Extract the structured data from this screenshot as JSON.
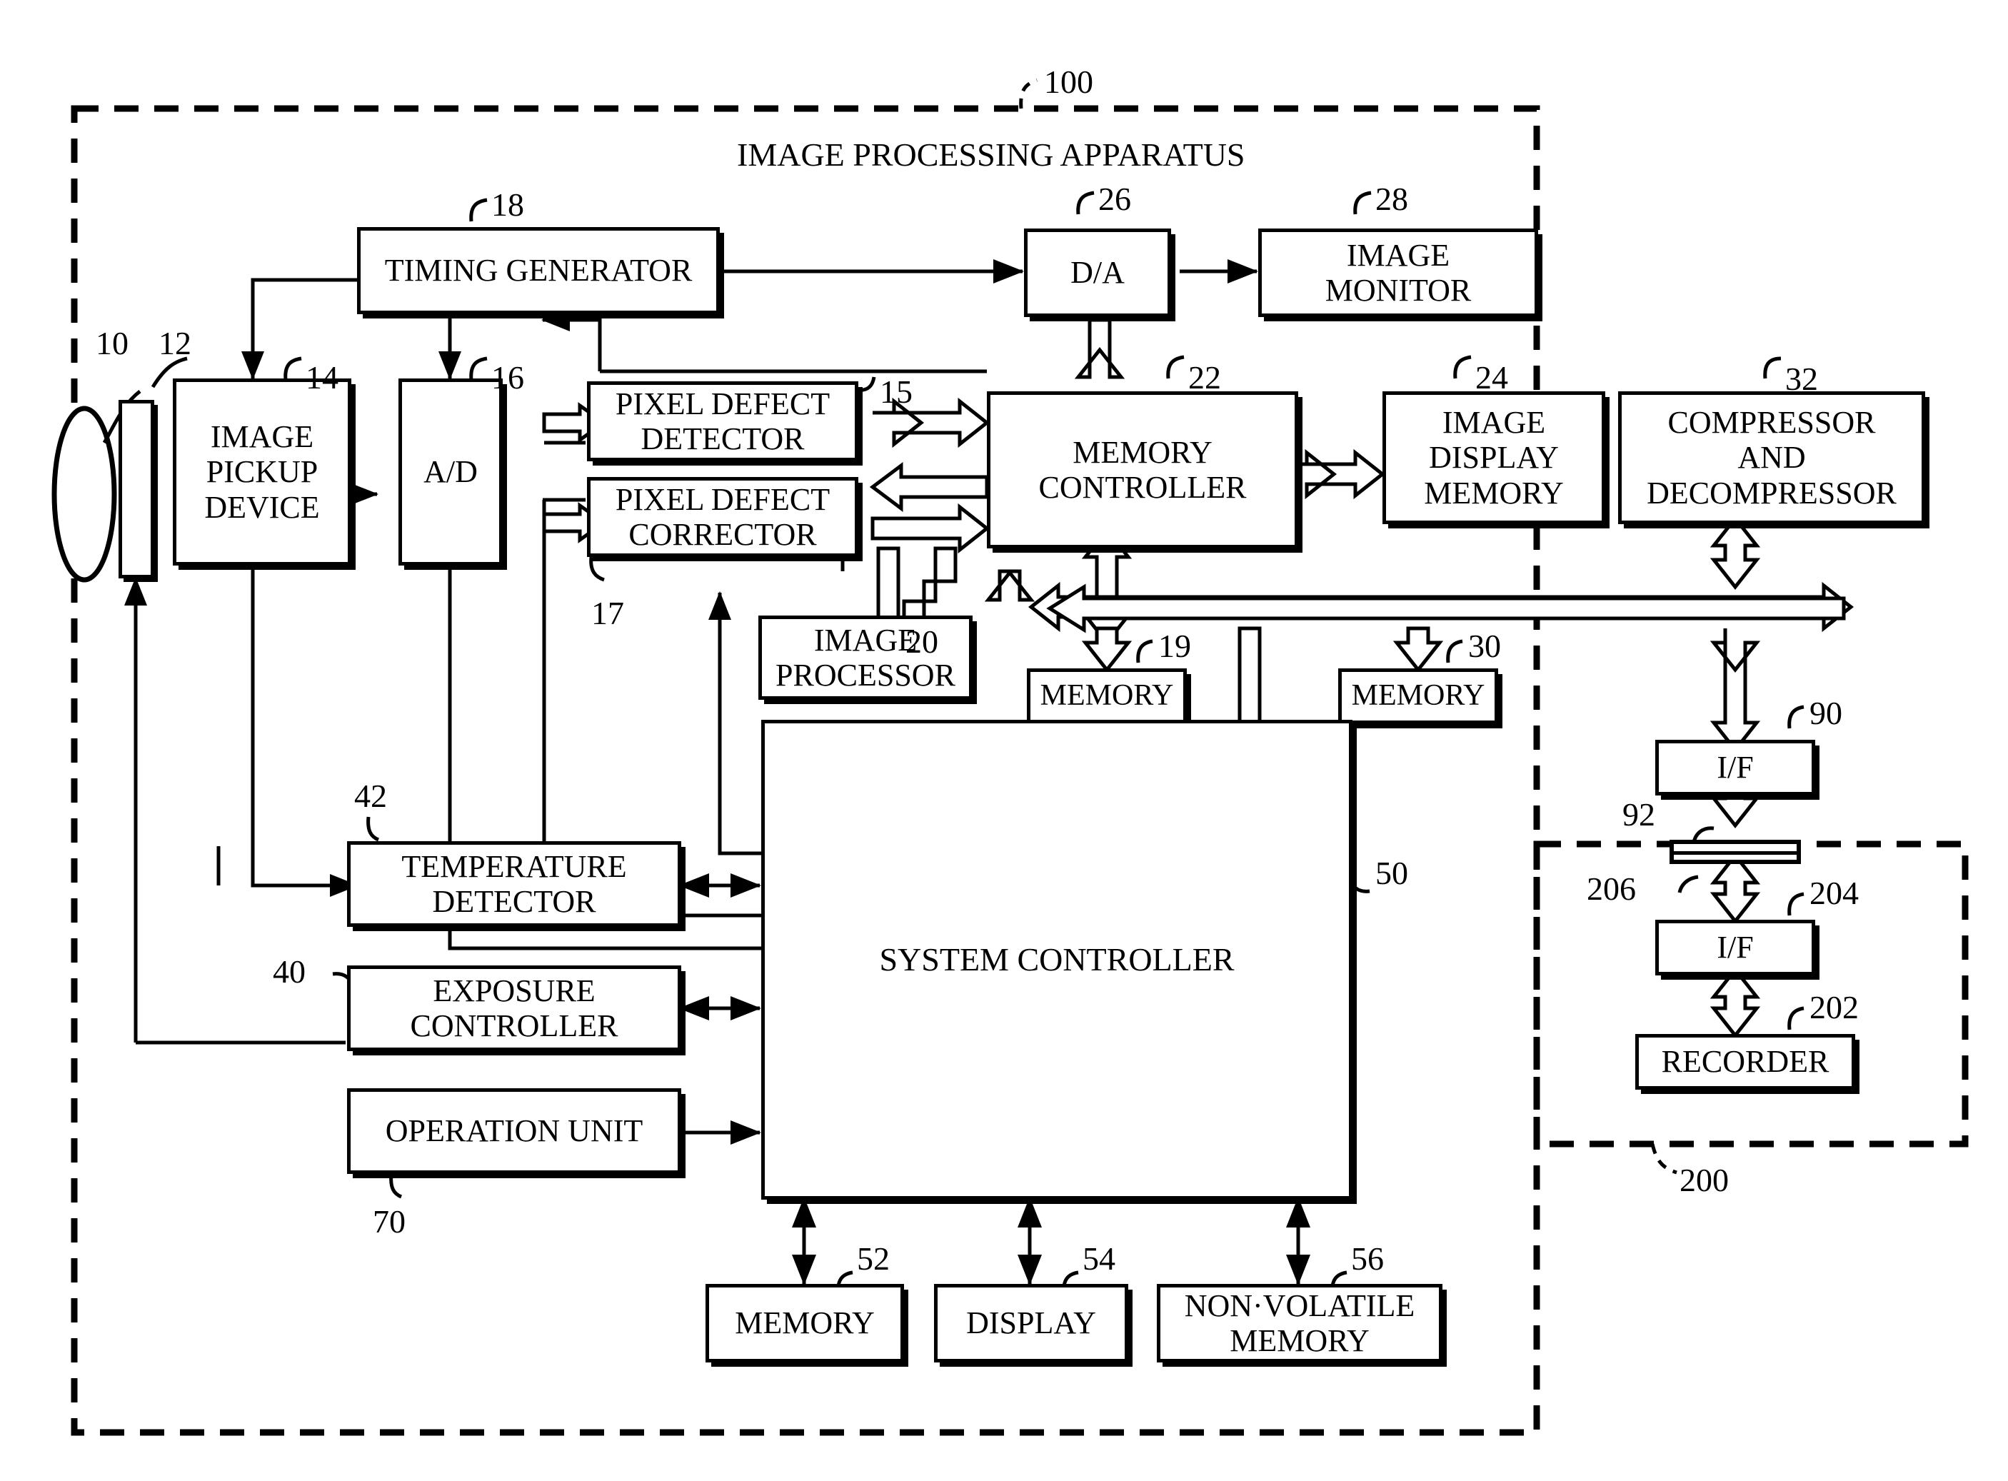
{
  "figure": {
    "title": "IMAGE PROCESSING APPARATUS",
    "apparatus_ref": "100",
    "recorder_unit_ref": "200"
  },
  "blocks": [
    {
      "id": "lens",
      "ref": "10",
      "label": ""
    },
    {
      "id": "shutter",
      "ref": "12",
      "label": ""
    },
    {
      "id": "image_pickup",
      "ref": "14",
      "label": "IMAGE\nPICKUP\nDEVICE"
    },
    {
      "id": "ad",
      "ref": "16",
      "label": "A/D"
    },
    {
      "id": "timing_gen",
      "ref": "18",
      "label": "TIMING GENERATOR"
    },
    {
      "id": "pixel_detector",
      "ref": "15",
      "label": "PIXEL DEFECT\nDETECTOR"
    },
    {
      "id": "pixel_corrector",
      "ref": "17",
      "label": "PIXEL DEFECT\nCORRECTOR"
    },
    {
      "id": "image_processor",
      "ref": "20",
      "label": "IMAGE\nPROCESSOR"
    },
    {
      "id": "memory_ctrl",
      "ref": "22",
      "label": "MEMORY\nCONTROLLER"
    },
    {
      "id": "memory19",
      "ref": "19",
      "label": "MEMORY"
    },
    {
      "id": "da",
      "ref": "26",
      "label": "D/A"
    },
    {
      "id": "image_monitor",
      "ref": "28",
      "label": "IMAGE\nMONITOR"
    },
    {
      "id": "image_disp_mem",
      "ref": "24",
      "label": "IMAGE\nDISPLAY\nMEMORY"
    },
    {
      "id": "compressor",
      "ref": "32",
      "label": "COMPRESSOR\nAND\nDECOMPRESSOR"
    },
    {
      "id": "memory30",
      "ref": "30",
      "label": "MEMORY"
    },
    {
      "id": "if90",
      "ref": "90",
      "label": "I/F"
    },
    {
      "id": "connector92",
      "ref": "92",
      "label": ""
    },
    {
      "id": "connector206",
      "ref": "206",
      "label": ""
    },
    {
      "id": "if204",
      "ref": "204",
      "label": "I/F"
    },
    {
      "id": "recorder",
      "ref": "202",
      "label": "RECORDER"
    },
    {
      "id": "temp_detector",
      "ref": "42",
      "label": "TEMPERATURE\nDETECTOR"
    },
    {
      "id": "exposure_ctrl",
      "ref": "40",
      "label": "EXPOSURE\nCONTROLLER"
    },
    {
      "id": "operation_unit",
      "ref": "70",
      "label": "OPERATION UNIT"
    },
    {
      "id": "system_ctrl",
      "ref": "50",
      "label": "SYSTEM CONTROLLER"
    },
    {
      "id": "memory52",
      "ref": "52",
      "label": "MEMORY"
    },
    {
      "id": "display54",
      "ref": "54",
      "label": "DISPLAY"
    },
    {
      "id": "nvmemory56",
      "ref": "56",
      "label": "NON·VOLATILE\nMEMORY"
    }
  ],
  "labels": {
    "image_pickup_l1": "IMAGE",
    "image_pickup_l2": "PICKUP",
    "image_pickup_l3": "DEVICE",
    "ad": "A/D",
    "timing_gen": "TIMING GENERATOR",
    "pixel_detector_l1": "PIXEL DEFECT",
    "pixel_detector_l2": "DETECTOR",
    "pixel_corrector_l1": "PIXEL DEFECT",
    "pixel_corrector_l2": "CORRECTOR",
    "image_processor_l1": "IMAGE",
    "image_processor_l2": "PROCESSOR",
    "memory_ctrl_l1": "MEMORY",
    "memory_ctrl_l2": "CONTROLLER",
    "memory19": "MEMORY",
    "da": "D/A",
    "image_monitor_l1": "IMAGE",
    "image_monitor_l2": "MONITOR",
    "image_disp_mem_l1": "IMAGE",
    "image_disp_mem_l2": "DISPLAY",
    "image_disp_mem_l3": "MEMORY",
    "compressor_l1": "COMPRESSOR",
    "compressor_l2": "AND",
    "compressor_l3": "DECOMPRESSOR",
    "memory30": "MEMORY",
    "if90": "I/F",
    "if204": "I/F",
    "recorder": "RECORDER",
    "temp_detector_l1": "TEMPERATURE",
    "temp_detector_l2": "DETECTOR",
    "exposure_ctrl_l1": "EXPOSURE",
    "exposure_ctrl_l2": "CONTROLLER",
    "operation_unit": "OPERATION UNIT",
    "system_ctrl": "SYSTEM CONTROLLER",
    "memory52": "MEMORY",
    "display54": "DISPLAY",
    "nvmemory56_l1": "NON·VOLATILE",
    "nvmemory56_l2": "MEMORY",
    "apparatus_title": "IMAGE PROCESSING APPARATUS"
  },
  "refs": {
    "r10": "10",
    "r12": "12",
    "r14": "14",
    "r15": "15",
    "r16": "16",
    "r17": "17",
    "r18": "18",
    "r19": "19",
    "r20": "20",
    "r22": "22",
    "r24": "24",
    "r26": "26",
    "r28": "28",
    "r30": "30",
    "r32": "32",
    "r40": "40",
    "r42": "42",
    "r50": "50",
    "r52": "52",
    "r54": "54",
    "r56": "56",
    "r70": "70",
    "r90": "90",
    "r92": "92",
    "r100": "100",
    "r200": "200",
    "r202": "202",
    "r204": "204",
    "r206": "206"
  },
  "colors": {
    "ink": "#000000",
    "paper": "#ffffff"
  }
}
